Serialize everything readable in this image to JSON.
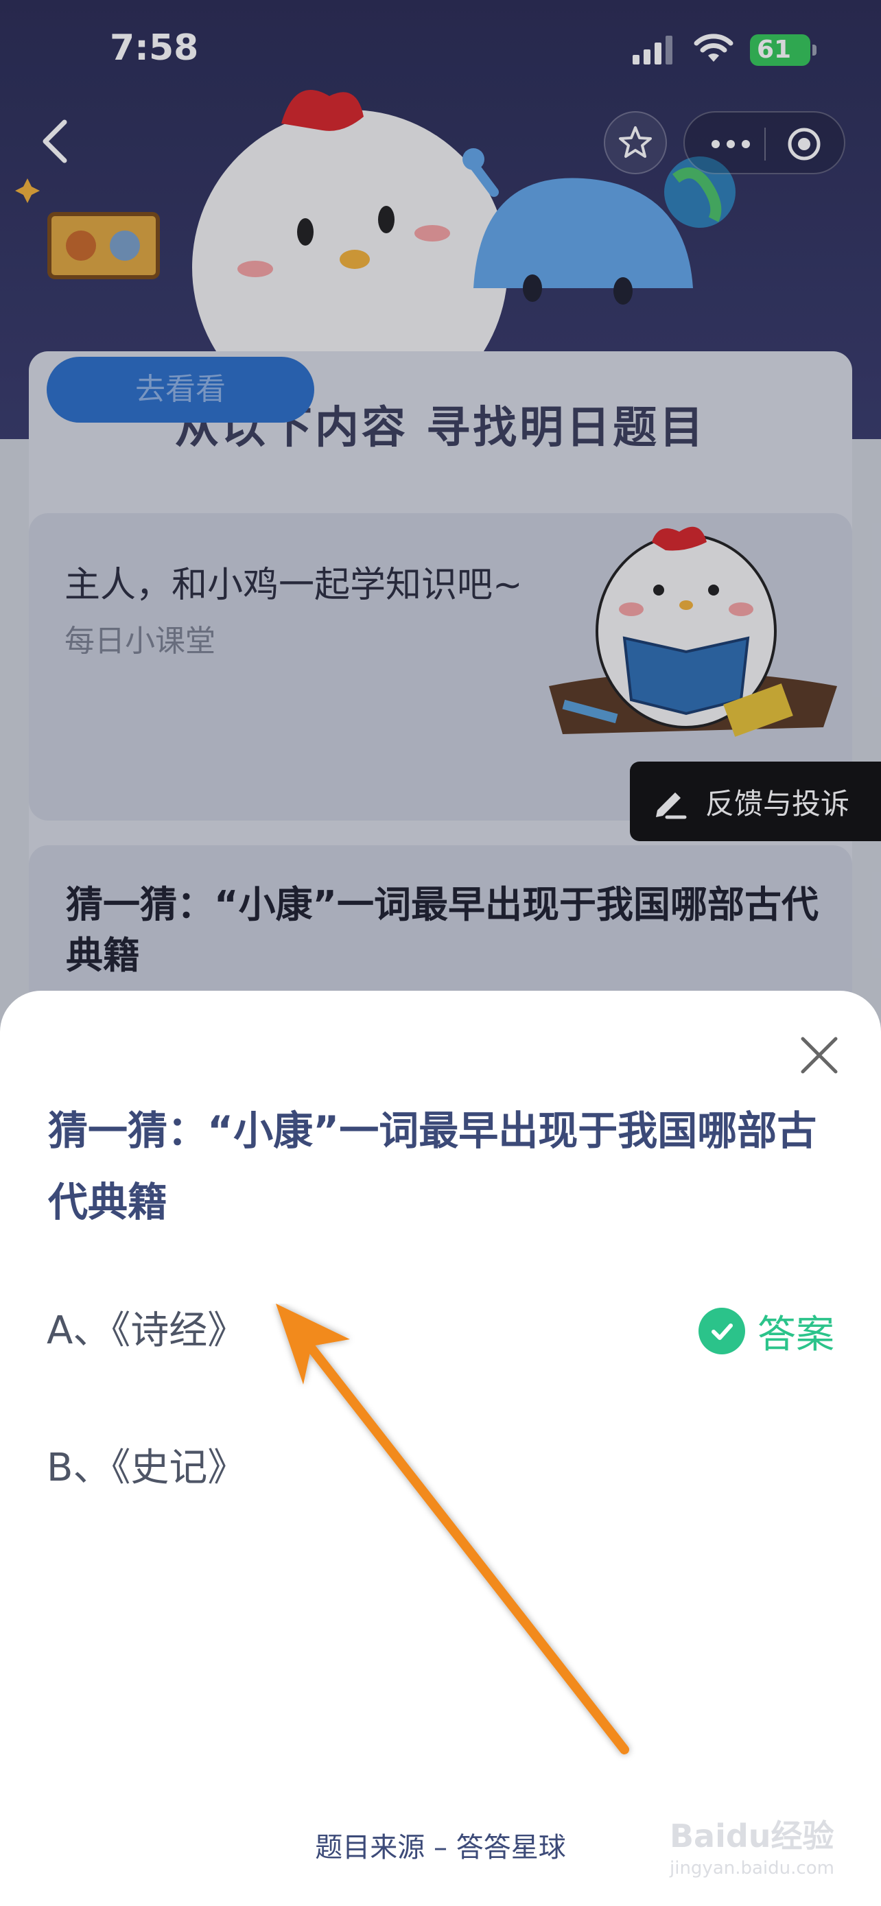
{
  "status_bar": {
    "time": "7:58",
    "battery": "61"
  },
  "background": {
    "section_title": "从以下内容  寻找明日题目",
    "course_card": {
      "title": "主人，和小鸡一起学知识吧~",
      "subtitle": "每日小课堂",
      "button": "去看看"
    },
    "feedback_label": "反馈与投诉",
    "quiz_card_title": "猜一猜：“小康”一词最早出现于我国哪部古代典籍"
  },
  "sheet": {
    "question": "猜一猜：“小康”一词最早出现于我国哪部古代典籍",
    "options": [
      {
        "label": "A、《诗经》",
        "is_answer": true
      },
      {
        "label": "B、《史记》",
        "is_answer": false
      }
    ],
    "answer_label": "答案",
    "source": "题目来源 – 答答星球"
  },
  "watermark": {
    "brand": "Baidu经验",
    "url": "jingyan.baidu.com"
  },
  "colors": {
    "accent_green": "#2bc38a",
    "question_blue": "#3c4a78",
    "arrow_orange": "#f28a1c"
  }
}
